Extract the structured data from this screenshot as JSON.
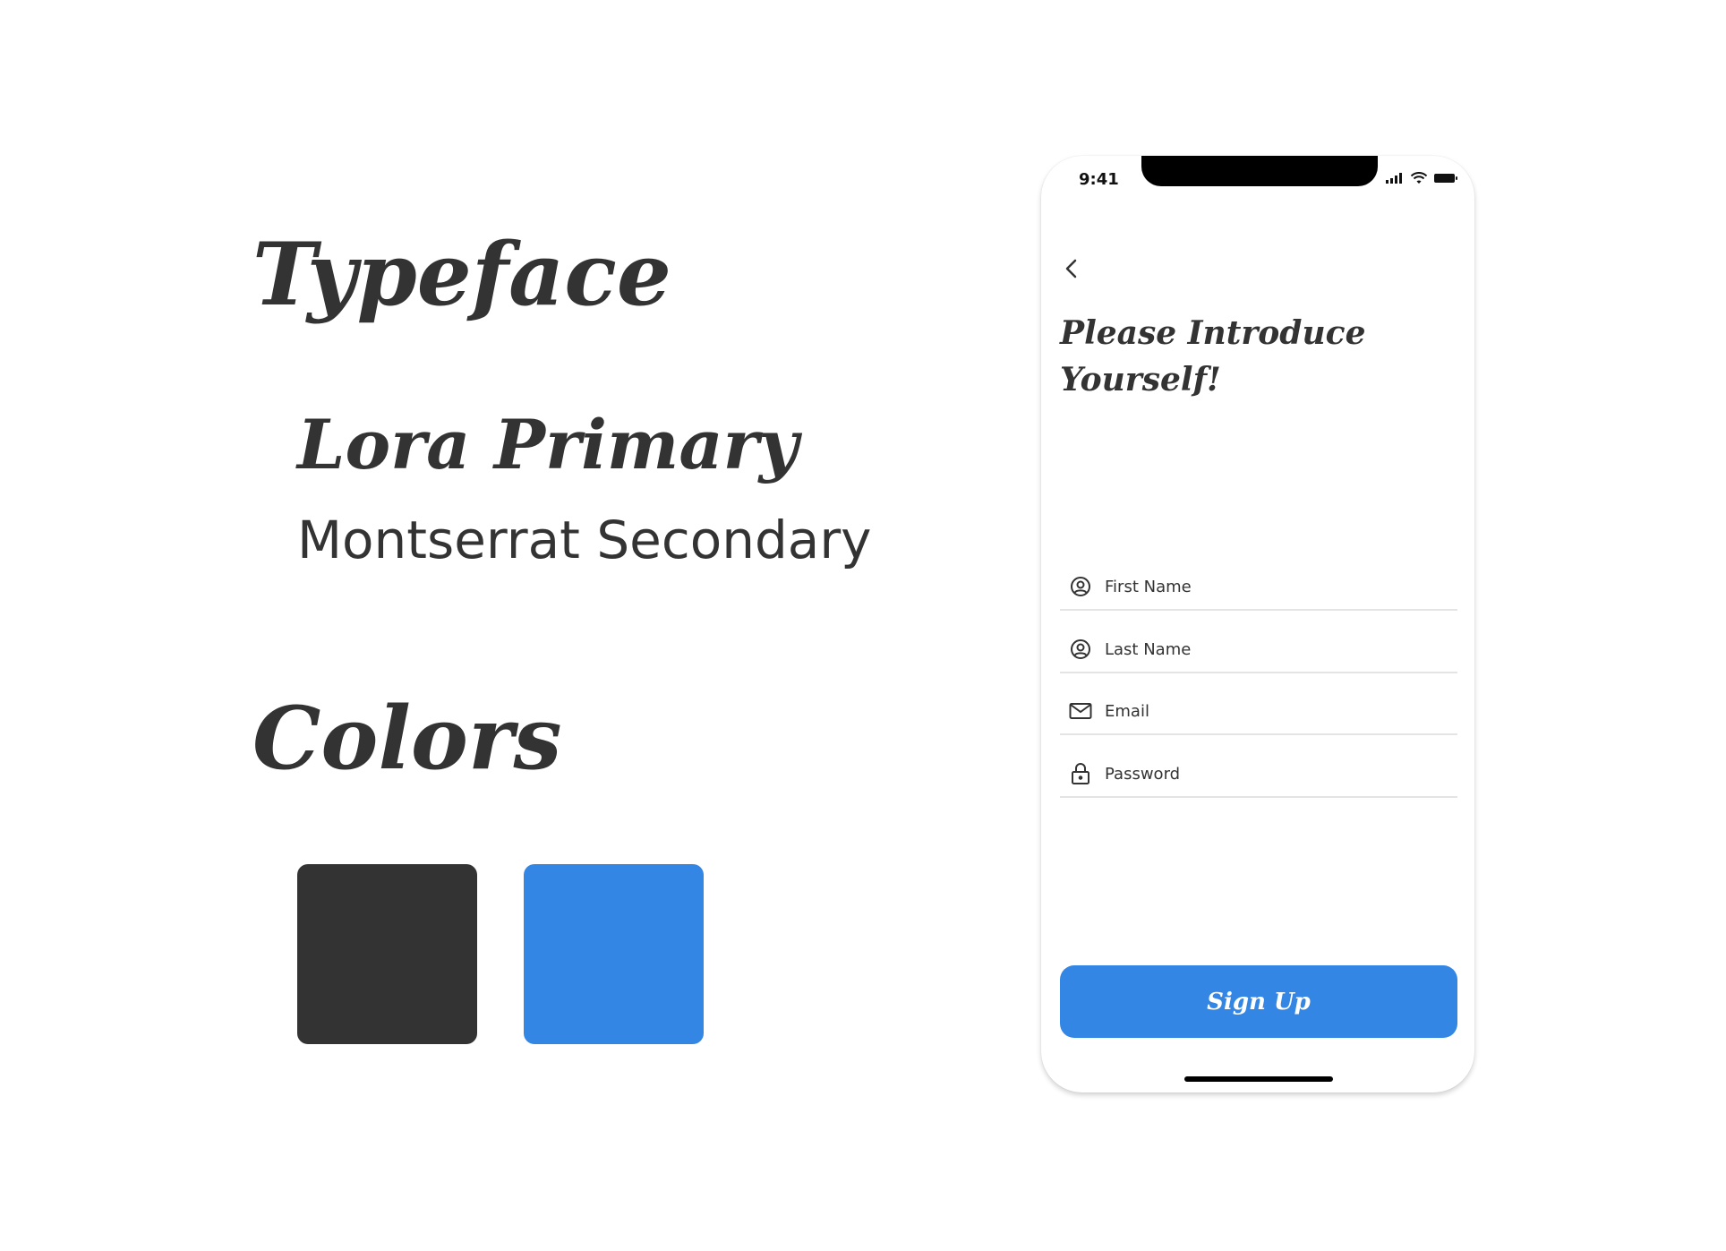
{
  "guide": {
    "typeface_heading": "Typeface",
    "primary_font": "Lora Primary",
    "secondary_font": "Montserrat Secondary",
    "colors_heading": "Colors",
    "swatches": [
      "#333333",
      "#3486E5"
    ]
  },
  "phone": {
    "status": {
      "time": "9:41"
    },
    "icons": {
      "back": "chevron-left-icon",
      "signal": "signal-icon",
      "wifi": "wifi-icon",
      "battery": "battery-icon"
    },
    "title": "Please Introduce Yourself!",
    "fields": {
      "first_name": {
        "placeholder": "First Name",
        "icon": "user-circle-icon"
      },
      "last_name": {
        "placeholder": "Last Name",
        "icon": "user-circle-icon"
      },
      "email": {
        "placeholder": "Email",
        "icon": "mail-icon"
      },
      "password": {
        "placeholder": "Password",
        "icon": "lock-icon"
      }
    },
    "signup_label": "Sign Up",
    "accent": "#3486E5"
  }
}
